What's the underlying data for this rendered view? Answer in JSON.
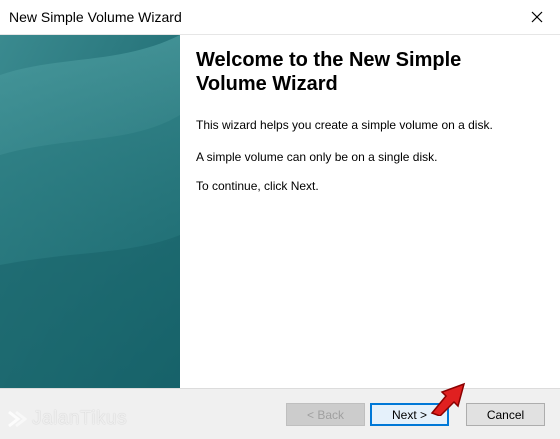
{
  "window": {
    "title": "New Simple Volume Wizard",
    "close_glyph": "✕"
  },
  "content": {
    "heading": "Welcome to the New Simple Volume Wizard",
    "paragraphs": [
      "This wizard helps you create a simple volume on a disk.",
      "A simple volume can only be on a single disk.",
      "To continue, click Next."
    ]
  },
  "buttons": {
    "back": "< Back",
    "next": "Next >",
    "cancel": "Cancel"
  },
  "watermark": {
    "text": "JalanTikus"
  },
  "colors": {
    "banner": "#2a7a80",
    "next_border": "#0078d7",
    "arrow": "#e02020"
  }
}
